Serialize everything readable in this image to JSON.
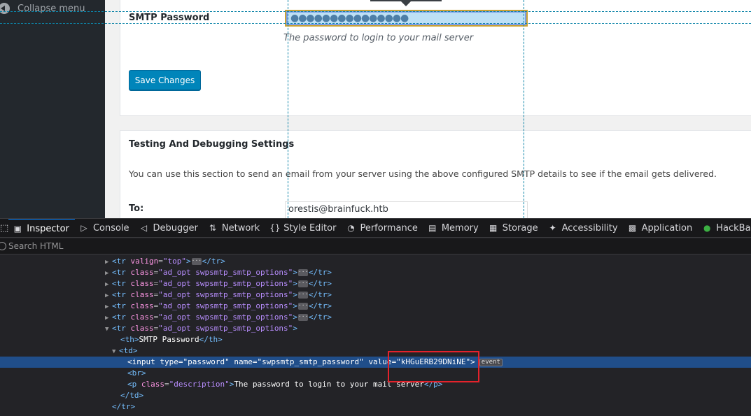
{
  "sidebar": {
    "collapse_label": "Collapse menu"
  },
  "smtp_settings": {
    "password_label": "SMTP Password",
    "password_value": "●●●●●●●●●●●●●●●",
    "password_description": "The password to login to your mail server",
    "save_button": "Save Changes"
  },
  "testing": {
    "heading": "Testing And Debugging Settings",
    "help_text": "You can use this section to send an email from your server using the above configured SMTP details to see if the email gets delivered.",
    "to_label": "To:",
    "to_value": "orestis@brainfuck.htb"
  },
  "devtools": {
    "tabs": [
      {
        "label": "Inspector",
        "icon": "inspector-icon"
      },
      {
        "label": "Console",
        "icon": "console-icon"
      },
      {
        "label": "Debugger",
        "icon": "debugger-icon"
      },
      {
        "label": "Network",
        "icon": "network-icon"
      },
      {
        "label": "Style Editor",
        "icon": "style-editor-icon"
      },
      {
        "label": "Performance",
        "icon": "performance-icon"
      },
      {
        "label": "Memory",
        "icon": "memory-icon"
      },
      {
        "label": "Storage",
        "icon": "storage-icon"
      },
      {
        "label": "Accessibility",
        "icon": "accessibility-icon"
      },
      {
        "label": "Application",
        "icon": "application-icon"
      },
      {
        "label": "HackBar",
        "icon": "hackbar-icon"
      }
    ],
    "search_placeholder": "Search HTML",
    "code": {
      "tr_valign": "tr",
      "valign_attr": "valign",
      "valign_val": "\"top\"",
      "tr_class_attr": "class",
      "tr_class_val": "\"ad_opt swpsmtp_smtp_options\"",
      "th_text": "SMTP Password",
      "input_type_val": "\"password\"",
      "input_name_val": "\"swpsmtp_smtp_password\"",
      "input_value_val": "\"kHGuERB29DNiNE\"",
      "event_badge": "event",
      "p_class_val": "\"description\"",
      "p_text": "The password to login to your mail server"
    }
  },
  "colors": {
    "accent": "#0a84ff",
    "wp_button": "#0085ba",
    "selection": "#204e8a",
    "highlight_box": "#e4222b"
  }
}
